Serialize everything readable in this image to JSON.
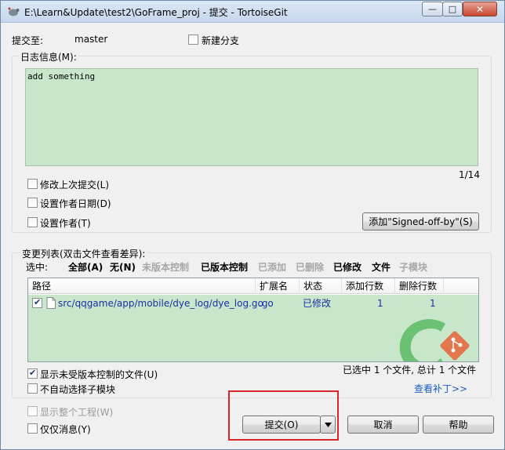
{
  "window": {
    "title": "E:\\Learn&Update\\test2\\GoFrame_proj - 提交 - TortoiseGit",
    "min_label": "—",
    "max_label": "□",
    "close_label": "✕"
  },
  "commit_to": {
    "label": "提交至:",
    "branch": "master",
    "new_branch_label": "新建分支",
    "new_branch_checked": false
  },
  "message": {
    "group_label": "日志信息(M):",
    "text": "add something",
    "counter": "1/14",
    "amend_label": "修改上次提交(L)",
    "set_date_label": "设置作者日期(D)",
    "set_author_label": "设置作者(T)",
    "signoff_button": "添加\"Signed-off-by\"(S)"
  },
  "changes": {
    "group_label": "变更列表(双击文件查看差异):",
    "select_label": "选中:",
    "filters": [
      {
        "label": "全部(A)",
        "style": "bold"
      },
      {
        "label": "无(N)",
        "style": "bold"
      },
      {
        "label": "未版本控制",
        "style": "gray"
      },
      {
        "label": "已版本控制",
        "style": "bold"
      },
      {
        "label": "已添加",
        "style": "gray"
      },
      {
        "label": "已删除",
        "style": "gray"
      },
      {
        "label": "已修改",
        "style": "bold"
      },
      {
        "label": "文件",
        "style": "bold"
      },
      {
        "label": "子模块",
        "style": "gray"
      }
    ],
    "columns": [
      "路径",
      "扩展名",
      "状态",
      "添加行数",
      "删除行数"
    ],
    "rows": [
      {
        "checked": true,
        "path": "src/qqgame/app/mobile/dye_log/dye_log.go",
        "ext": ".go",
        "status": "已修改",
        "added": "1",
        "deleted": "1"
      }
    ],
    "show_unversioned_label": "显示未受版本控制的文件(U)",
    "show_unversioned_checked": true,
    "no_autoselect_submodules_label": "不自动选择子模块",
    "summary": "已选中 1 个文件, 总计 1 个文件",
    "view_patch_link": "查看补丁>>"
  },
  "bottom": {
    "show_whole_project_label": "显示整个工程(W)",
    "message_only_label": "仅仅消息(Y)",
    "commit_button": "提交(O)",
    "cancel_button": "取消",
    "help_button": "帮助",
    "highlight_color": "#d8242b"
  }
}
